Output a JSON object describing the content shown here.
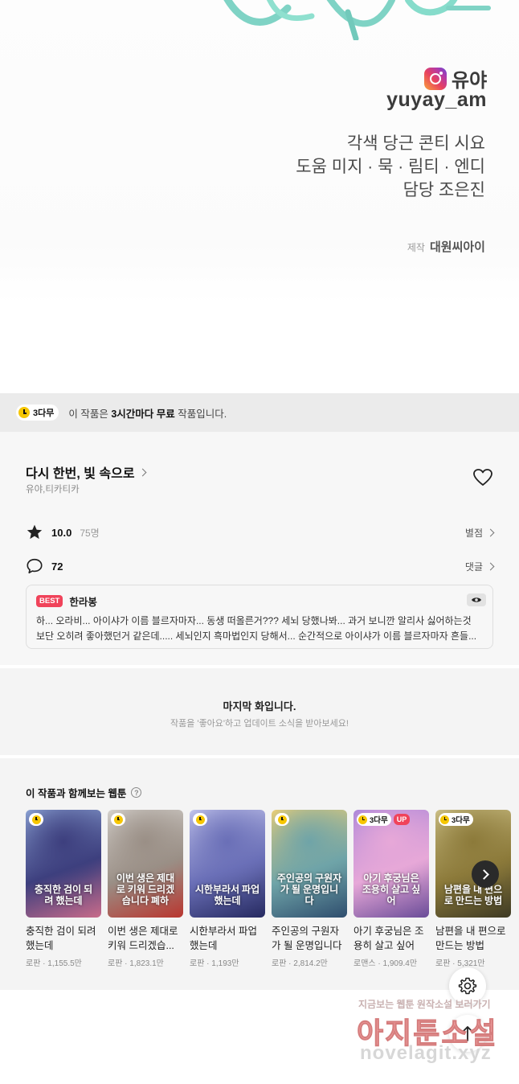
{
  "credits": {
    "instagram_name": "유야",
    "instagram_id": "yuyay_am",
    "lines": [
      "각색 당근 콘티 시요",
      "도움 미지 · 묵 · 림티 · 엔디",
      "담당  조은진"
    ],
    "production_label": "제작",
    "production_name": "대원씨아이"
  },
  "notice": {
    "badge": "3다무",
    "prefix": "이 작품은 ",
    "highlight": "3시간마다 무료",
    "suffix": " 작품입니다."
  },
  "work": {
    "title": "다시 한번, 빛 속으로",
    "author": "유야,티카티카",
    "rating": "10.0",
    "rating_count": "75명",
    "rating_link": "별점",
    "comments": "72",
    "comments_link": "댓글"
  },
  "best_comment": {
    "tag": "BEST",
    "author": "한라봉",
    "line1": "하... 오라비... 아이샤가 이름 블르자마자... 동생 떠올른거??? 세뇌 당했나봐... 과거 보니깐 알리사 싫어하는것",
    "line2": "보단 오히려 좋아했던거 같은데..... 세뇌인지 흑마법인지 당해서... 순간적으로 아이샤가 이름 블르자마자 흔들..."
  },
  "last_episode": {
    "title": "마지막 화입니다.",
    "subtitle": "작품을 '좋아요'하고 업데이트 소식을 받아보세요!"
  },
  "recommendations": {
    "title": "이 작품과 함께보는 웹툰",
    "help": "?",
    "items": [
      {
        "title": "충직한 검이 되려 했는데",
        "genre": "로판",
        "views": "1,155.5만",
        "badge": "clock",
        "cover_text": "충직한 검이 되려 했는데",
        "colors": [
          "#8fa7d8",
          "#3d3f7e",
          "#c86b8a"
        ]
      },
      {
        "title": "이번 생은 제대로 키워 드리겠습...",
        "genre": "로판",
        "views": "1,823.1만",
        "badge": "clock",
        "cover_text": "이번 생은 제대로 키워 드리겠습니다 폐하",
        "colors": [
          "#d9d6d2",
          "#9a8f86",
          "#b9362f"
        ]
      },
      {
        "title": "시한부라서 파업했는데",
        "genre": "로판",
        "views": "1,193만",
        "badge": "clock",
        "cover_text": "시한부라서 파업했는데",
        "colors": [
          "#c7c9ef",
          "#6a6fb7",
          "#262a60"
        ]
      },
      {
        "title": "주인공의 구원자가 될 운명입니다",
        "genre": "로판",
        "views": "2,814.2만",
        "badge": "clock",
        "cover_text": "주인공의 구원자가 될 운명입니다",
        "colors": [
          "#f1d074",
          "#6fa4a8",
          "#2f4e6e"
        ]
      },
      {
        "title": "아기 후궁님은 조용히 살고 싶어",
        "genre": "로맨스",
        "views": "1,909.4만",
        "badge": "3다무",
        "up": "UP",
        "cover_text": "아기 후궁님은 조용히 살고 싶어",
        "colors": [
          "#a986d9",
          "#e7a8d8",
          "#6a4c98"
        ]
      },
      {
        "title": "남편을 내 편으로 만드는 방법",
        "genre": "로판",
        "views": "5,321만",
        "badge": "3다무",
        "cover_text": "남편을 내 편으로 만드는 방법",
        "colors": [
          "#cfc38a",
          "#8c7a3a",
          "#3e3a24"
        ]
      }
    ]
  },
  "watermark": {
    "top": "지금보는 웹툰 원작소설 보러가기",
    "middle": "아지툰소설",
    "bottom": "novelagit.xyz"
  },
  "colors": {
    "notice_bg": "#ebebeb",
    "badge_yellow": "#f6c600",
    "best_red": "#f0435a",
    "title_art_teal": "#7fd3c5"
  }
}
